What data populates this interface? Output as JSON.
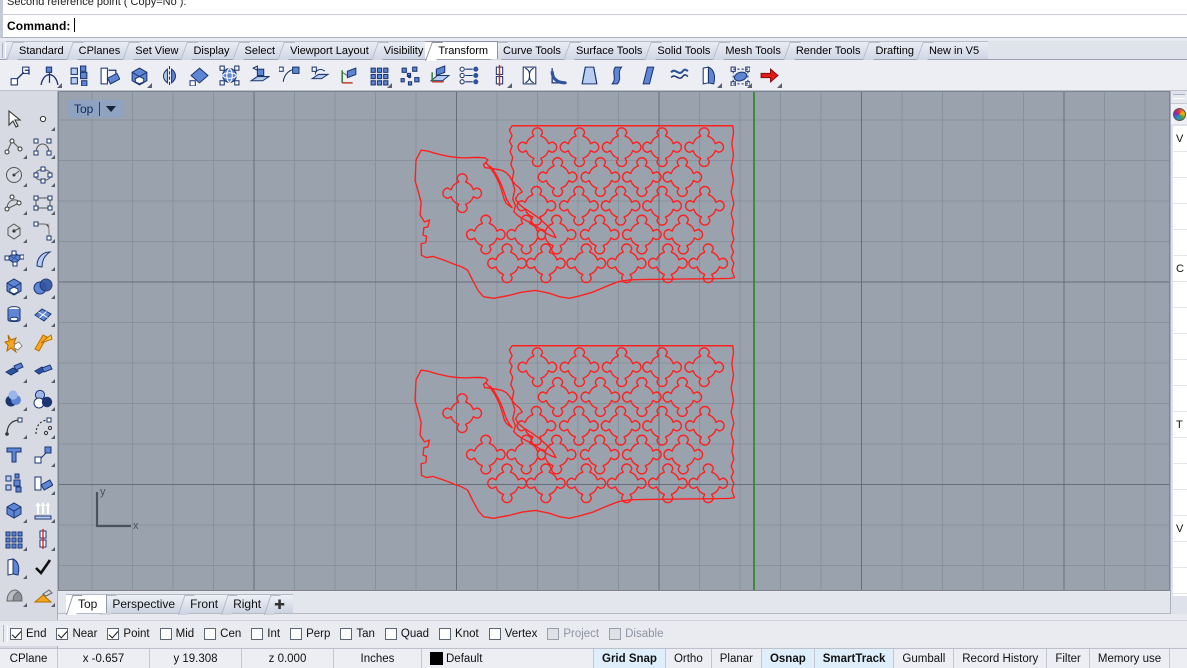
{
  "command": {
    "history_line": "Second reference point ( Copy=No ):",
    "prompt_label": "Command:",
    "input_value": ""
  },
  "tabs": {
    "items": [
      {
        "label": "Standard",
        "active": false
      },
      {
        "label": "CPlanes",
        "active": false
      },
      {
        "label": "Set View",
        "active": false
      },
      {
        "label": "Display",
        "active": false
      },
      {
        "label": "Select",
        "active": false
      },
      {
        "label": "Viewport Layout",
        "active": false
      },
      {
        "label": "Visibility",
        "active": false
      },
      {
        "label": "Transform",
        "active": true
      },
      {
        "label": "Curve Tools",
        "active": false
      },
      {
        "label": "Surface Tools",
        "active": false
      },
      {
        "label": "Solid Tools",
        "active": false
      },
      {
        "label": "Mesh Tools",
        "active": false
      },
      {
        "label": "Render Tools",
        "active": false
      },
      {
        "label": "Drafting",
        "active": false
      },
      {
        "label": "New in V5",
        "active": false
      }
    ]
  },
  "toolbar": {
    "items": [
      {
        "icon": "move-icon",
        "flyout": false
      },
      {
        "icon": "bend-icon",
        "flyout": true
      },
      {
        "icon": "copy-icon",
        "flyout": false
      },
      {
        "icon": "rotate-icon",
        "flyout": false
      },
      {
        "icon": "scale-3d-icon",
        "flyout": true
      },
      {
        "icon": "mirror-icon",
        "flyout": false
      },
      {
        "icon": "orient-icon",
        "flyout": false
      },
      {
        "icon": "rotate-3d-icon",
        "flyout": false
      },
      {
        "icon": "project-to-plane-icon",
        "flyout": false
      },
      {
        "icon": "shear-icon",
        "flyout": false
      },
      {
        "icon": "flow-along-surface-icon",
        "flyout": false
      },
      {
        "icon": "set-points-icon",
        "flyout": false
      },
      {
        "icon": "array-rectangular-icon",
        "flyout": true
      },
      {
        "icon": "array-random-icon",
        "flyout": false
      },
      {
        "icon": "orient-on-surface-icon",
        "flyout": false
      },
      {
        "icon": "array-linear-icon",
        "flyout": false
      },
      {
        "icon": "array-polar-icon",
        "flyout": true
      },
      {
        "icon": "twist-icon",
        "flyout": false
      },
      {
        "icon": "bend-curve-icon",
        "flyout": false
      },
      {
        "icon": "taper-icon",
        "flyout": false
      },
      {
        "icon": "flow-icon",
        "flyout": false
      },
      {
        "icon": "flow-along-curve-icon",
        "flyout": false
      },
      {
        "icon": "smooth-icon",
        "flyout": false
      },
      {
        "icon": "splop-icon",
        "flyout": true
      },
      {
        "icon": "cage-edit-icon",
        "flyout": true
      },
      {
        "icon": "arrow-right-icon",
        "flyout": true
      }
    ]
  },
  "left_toolbar": {
    "rows": [
      [
        {
          "icon": "select-arrow-icon",
          "flyout": false
        },
        {
          "icon": "point-icon",
          "flyout": true
        }
      ],
      [
        {
          "icon": "polyline-icon",
          "flyout": true
        },
        {
          "icon": "curve-control-points-icon",
          "flyout": true
        }
      ],
      [
        {
          "icon": "circle-center-icon",
          "flyout": true
        },
        {
          "icon": "ellipse-icon",
          "flyout": true
        }
      ],
      [
        {
          "icon": "arc-icon",
          "flyout": true
        },
        {
          "icon": "rectangle-icon",
          "flyout": true
        }
      ],
      [
        {
          "icon": "polygon-icon",
          "flyout": true
        },
        {
          "icon": "fillet-curve-icon",
          "flyout": true
        }
      ],
      [
        {
          "icon": "surface-control-points-icon",
          "flyout": true
        },
        {
          "icon": "surface-sweep-icon",
          "flyout": true
        }
      ],
      [
        {
          "icon": "box-icon",
          "flyout": true
        },
        {
          "icon": "sphere-boolean-icon",
          "flyout": true
        }
      ],
      [
        {
          "icon": "cylinder-icon",
          "flyout": true
        },
        {
          "icon": "mesh-icon",
          "flyout": true
        }
      ],
      [
        {
          "icon": "explode-icon",
          "flyout": false
        },
        {
          "icon": "trim-icon",
          "flyout": false
        }
      ],
      [
        {
          "icon": "split-icon",
          "flyout": true
        },
        {
          "icon": "join-icon",
          "flyout": true
        }
      ],
      [
        {
          "icon": "boolean-union-icon",
          "flyout": true
        },
        {
          "icon": "boolean-difference-icon",
          "flyout": true
        }
      ],
      [
        {
          "icon": "offset-curve-icon",
          "flyout": true
        },
        {
          "icon": "blend-curve-icon",
          "flyout": true
        }
      ],
      [
        {
          "icon": "text-icon",
          "flyout": false
        },
        {
          "icon": "move-small-icon",
          "flyout": true
        }
      ],
      [
        {
          "icon": "copy-small-icon",
          "flyout": false
        },
        {
          "icon": "rotate-small-icon",
          "flyout": true
        }
      ],
      [
        {
          "icon": "scale-small-icon",
          "flyout": true
        },
        {
          "icon": "extrude-icon",
          "flyout": true
        }
      ],
      [
        {
          "icon": "array-icon",
          "flyout": true
        },
        {
          "icon": "set-points-small-icon",
          "flyout": true
        }
      ],
      [
        {
          "icon": "cage-small-icon",
          "flyout": true
        },
        {
          "icon": "check-icon",
          "flyout": false
        }
      ],
      [
        {
          "icon": "shade-icon",
          "flyout": true
        },
        {
          "icon": "render-icon",
          "flyout": true
        }
      ]
    ]
  },
  "viewport": {
    "label": "Top",
    "dropdown_icon": "chevron-down-icon",
    "cplane_axis_x": "x",
    "cplane_axis_y": "y",
    "background_color": "#9aa3ad",
    "grid_line_color": "#828c98",
    "grid_major_color": "#606874",
    "y_axis_color": "#3e8b3e",
    "geometry_color": "#ff2020"
  },
  "viewport_tabs": {
    "items": [
      {
        "label": "Top",
        "active": true
      },
      {
        "label": "Perspective",
        "active": false
      },
      {
        "label": "Front",
        "active": false
      },
      {
        "label": "Right",
        "active": false
      }
    ],
    "add_label": "✚"
  },
  "osnap": {
    "items": [
      {
        "label": "End",
        "checked": true,
        "disabled": false
      },
      {
        "label": "Near",
        "checked": true,
        "disabled": false
      },
      {
        "label": "Point",
        "checked": true,
        "disabled": false
      },
      {
        "label": "Mid",
        "checked": false,
        "disabled": false
      },
      {
        "label": "Cen",
        "checked": false,
        "disabled": false
      },
      {
        "label": "Int",
        "checked": false,
        "disabled": false
      },
      {
        "label": "Perp",
        "checked": false,
        "disabled": false
      },
      {
        "label": "Tan",
        "checked": false,
        "disabled": false
      },
      {
        "label": "Quad",
        "checked": false,
        "disabled": false
      },
      {
        "label": "Knot",
        "checked": false,
        "disabled": false
      },
      {
        "label": "Vertex",
        "checked": false,
        "disabled": false
      },
      {
        "label": "Project",
        "checked": false,
        "disabled": true
      },
      {
        "label": "Disable",
        "checked": false,
        "disabled": true
      }
    ]
  },
  "statusbar": {
    "cplane_label": "CPlane",
    "x_value": "x -0.657",
    "y_value": "y 19.308",
    "z_value": "z 0.000",
    "units": "Inches",
    "layer_name": "Default",
    "layer_color": "#000000",
    "toggles": [
      {
        "label": "Grid Snap",
        "on": true
      },
      {
        "label": "Ortho",
        "on": false
      },
      {
        "label": "Planar",
        "on": false
      },
      {
        "label": "Osnap",
        "on": true
      },
      {
        "label": "SmartTrack",
        "on": true
      },
      {
        "label": "Gumball",
        "on": false
      },
      {
        "label": "Record History",
        "on": false
      },
      {
        "label": "Filter",
        "on": false
      },
      {
        "label": "Memory use",
        "on": false
      }
    ]
  },
  "right_panel": {
    "tab_icon": "layers-color-wheel-icon",
    "rows": [
      "V",
      "",
      "",
      "",
      "",
      "C",
      "",
      "",
      "",
      "",
      "",
      "T",
      "",
      "",
      "",
      "V",
      "",
      ""
    ]
  }
}
